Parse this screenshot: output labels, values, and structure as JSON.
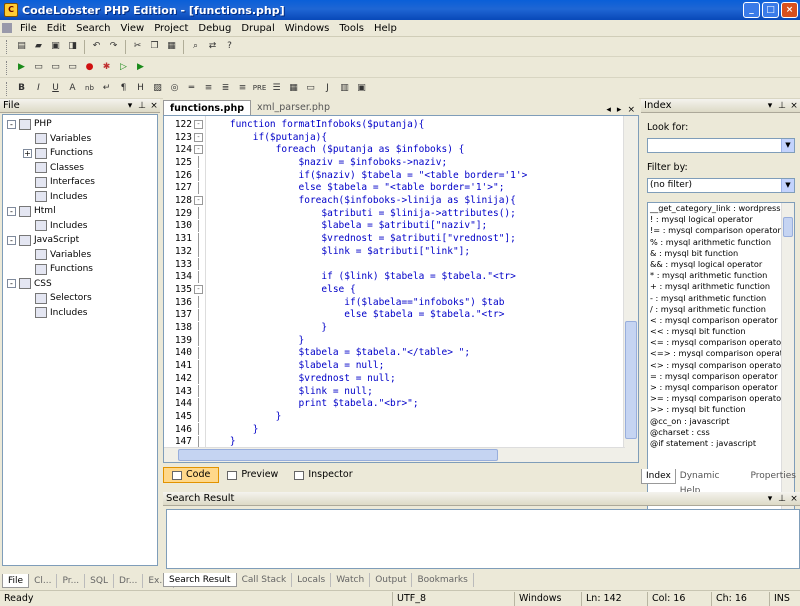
{
  "window": {
    "title": "CodeLobster PHP Edition - [functions.php]"
  },
  "menu": [
    "File",
    "Edit",
    "Search",
    "View",
    "Project",
    "Debug",
    "Drupal",
    "Windows",
    "Tools",
    "Help"
  ],
  "file_panel": {
    "title": "File",
    "tree": [
      {
        "label": "PHP",
        "level": 0,
        "expander": "-"
      },
      {
        "label": "Variables",
        "level": 1,
        "expander": ""
      },
      {
        "label": "Functions",
        "level": 1,
        "expander": "+"
      },
      {
        "label": "Classes",
        "level": 1,
        "expander": ""
      },
      {
        "label": "Interfaces",
        "level": 1,
        "expander": ""
      },
      {
        "label": "Includes",
        "level": 1,
        "expander": ""
      },
      {
        "label": "Html",
        "level": 0,
        "expander": "-"
      },
      {
        "label": "Includes",
        "level": 1,
        "expander": ""
      },
      {
        "label": "JavaScript",
        "level": 0,
        "expander": "-"
      },
      {
        "label": "Variables",
        "level": 1,
        "expander": ""
      },
      {
        "label": "Functions",
        "level": 1,
        "expander": ""
      },
      {
        "label": "CSS",
        "level": 0,
        "expander": "-"
      },
      {
        "label": "Selectors",
        "level": 1,
        "expander": ""
      },
      {
        "label": "Includes",
        "level": 1,
        "expander": ""
      }
    ],
    "tabs": [
      "File",
      "Cl...",
      "Pr...",
      "SQL",
      "Dr...",
      "Ex..."
    ]
  },
  "editor": {
    "tabs": [
      "functions.php",
      "xml_parser.php"
    ],
    "lines": [
      {
        "n": "122",
        "fold": "-",
        "code": "    function formatInfoboks($putanja){"
      },
      {
        "n": "123",
        "fold": "-",
        "code": "        if($putanja){"
      },
      {
        "n": "124",
        "fold": "-",
        "code": "            foreach ($putanja as $infoboks) {"
      },
      {
        "n": "125",
        "fold": "",
        "code": "                $naziv = $infoboks->naziv;"
      },
      {
        "n": "126",
        "fold": "",
        "code": "                if($naziv) $tabela = \"<table border='1'>"
      },
      {
        "n": "127",
        "fold": "",
        "code": "                else $tabela = \"<table border='1'>\";"
      },
      {
        "n": "128",
        "fold": "-",
        "code": "                foreach($infoboks->linija as $linija){"
      },
      {
        "n": "129",
        "fold": "",
        "code": "                    $atributi = $linija->attributes();"
      },
      {
        "n": "130",
        "fold": "",
        "code": "                    $labela = $atributi[\"naziv\"];"
      },
      {
        "n": "131",
        "fold": "",
        "code": "                    $vrednost = $atributi[\"vrednost\"];"
      },
      {
        "n": "132",
        "fold": "",
        "code": "                    $link = $atributi[\"link\"];"
      },
      {
        "n": "133",
        "fold": "",
        "code": ""
      },
      {
        "n": "134",
        "fold": "",
        "code": "                    if ($link) $tabela = $tabela.\"<tr>"
      },
      {
        "n": "135",
        "fold": "-",
        "code": "                    else {"
      },
      {
        "n": "136",
        "fold": "",
        "code": "                        if($labela==\"infoboks\") $tab"
      },
      {
        "n": "137",
        "fold": "",
        "code": "                        else $tabela = $tabela.\"<tr>"
      },
      {
        "n": "138",
        "fold": "",
        "code": "                    }"
      },
      {
        "n": "139",
        "fold": "",
        "code": "                }"
      },
      {
        "n": "140",
        "fold": "",
        "code": "                $tabela = $tabela.\"</table> \";"
      },
      {
        "n": "141",
        "fold": "",
        "code": "                $labela = null;"
      },
      {
        "n": "142",
        "fold": "",
        "code": "                $vrednost = null;"
      },
      {
        "n": "143",
        "fold": "",
        "code": "                $link = null;"
      },
      {
        "n": "144",
        "fold": "",
        "code": "                print $tabela.\"<br>\";"
      },
      {
        "n": "145",
        "fold": "",
        "code": "            }"
      },
      {
        "n": "146",
        "fold": "",
        "code": "        }"
      },
      {
        "n": "147",
        "fold": "",
        "code": "    }"
      }
    ],
    "view_tabs": [
      "Code",
      "Preview",
      "Inspector"
    ]
  },
  "index_panel": {
    "title": "Index",
    "look_for_label": "Look for:",
    "look_for_value": "",
    "filter_label": "Filter by:",
    "filter_value": "(no filter)",
    "items": [
      "__get_category_link : wordpress",
      "! : mysql logical operator",
      "!= : mysql comparison operator",
      "% : mysql arithmetic function",
      "& : mysql bit function",
      "&& : mysql logical operator",
      "* : mysql arithmetic function",
      "+ : mysql arithmetic function",
      "- : mysql arithmetic function",
      "/ : mysql arithmetic function",
      "< : mysql comparison operator",
      "<< : mysql bit function",
      "<= : mysql comparison operator",
      "<=> : mysql comparison operato",
      "<> : mysql comparison operator",
      "= : mysql comparison operator",
      "> : mysql comparison operator",
      ">= : mysql comparison operator",
      ">> : mysql bit function",
      "@cc_on : javascript",
      "@charset : css",
      "@if statement : javascript"
    ],
    "tabs": [
      "Index",
      "Dynamic Help",
      "Properties"
    ]
  },
  "search_result": {
    "title": "Search Result",
    "tabs": [
      "Search Result",
      "Call Stack",
      "Locals",
      "Watch",
      "Output",
      "Bookmarks"
    ]
  },
  "status": {
    "ready": "Ready",
    "encoding": "UTF_8",
    "os": "Windows",
    "ln": "Ln: 142",
    "col": "Col: 16",
    "ch": "Ch: 16",
    "mode": "INS"
  }
}
